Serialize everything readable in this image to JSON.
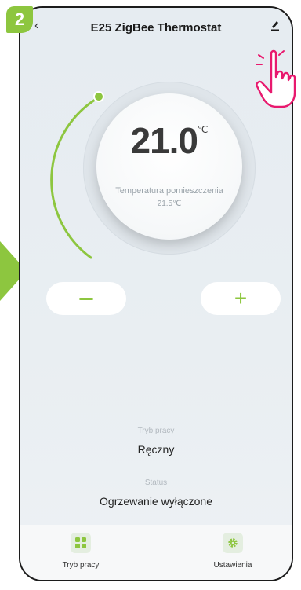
{
  "step_badge": "2",
  "header": {
    "title": "E25 ZigBee Thermostat",
    "back_icon": "chevron-left-icon",
    "edit_icon": "pencil-icon"
  },
  "dial": {
    "setpoint": "21.0",
    "unit": "℃",
    "room_label": "Temperatura pomieszczenia",
    "room_value": "21.5℃",
    "accent": "#8dc63f"
  },
  "controls": {
    "minus": "−",
    "plus": "+"
  },
  "mode": {
    "label": "Tryb pracy",
    "value": "Ręczny"
  },
  "status": {
    "label": "Status",
    "value": "Ogrzewanie wyłączone"
  },
  "tabs": [
    {
      "label": "Tryb pracy",
      "icon": "grid-icon"
    },
    {
      "label": "Ustawienia",
      "icon": "gear-icon"
    }
  ],
  "colors": {
    "accent": "#8dc63f",
    "highlight": "#e8196e"
  }
}
